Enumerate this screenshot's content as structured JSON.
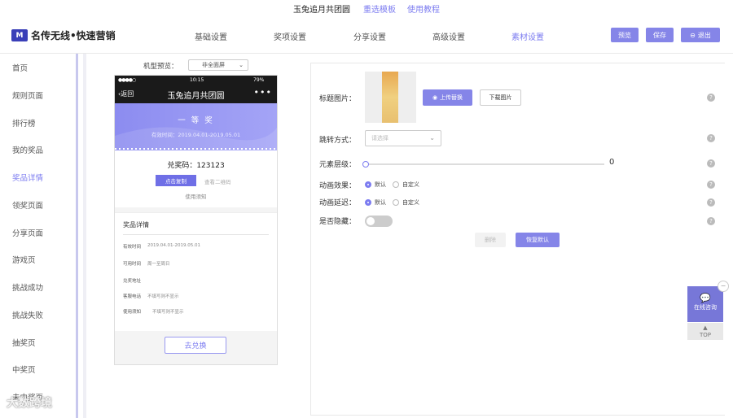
{
  "topbar": {
    "title": "玉兔追月共团圆",
    "reselect_template": "重选模板",
    "tutorial": "使用教程"
  },
  "header": {
    "logo_mark": "M",
    "logo_text": "名传无线•快速营销",
    "nav": [
      "基础设置",
      "奖项设置",
      "分享设置",
      "高级设置",
      "素材设置"
    ],
    "active_nav": "素材设置",
    "preview_button": "预览",
    "save_button": "保存",
    "exit_button": "退出"
  },
  "sidebar": {
    "items": [
      "首页",
      "规则页面",
      "排行榜",
      "我的奖品",
      "奖品详情",
      "领奖页面",
      "分享页面",
      "游戏页",
      "挑战成功",
      "挑战失败",
      "抽奖页",
      "中奖页",
      "未中奖页"
    ],
    "active": "奖品详情"
  },
  "preview": {
    "model_label": "机型预览：",
    "model_value": "非全面屏",
    "status_time": "10:15",
    "status_battery": "79%",
    "status_signal": "●●●●○",
    "back": "返回",
    "title": "玉兔追月共团圆",
    "more": "•••",
    "prize_name": "一 等 奖",
    "validity": "有效时间：2019.04.01-2019.05.01",
    "code_label": "兑奖码：123123",
    "copy_button": "点击复制",
    "qr_link": "查看二维码",
    "usage_note": "使用须知",
    "details_title": "奖品详情",
    "details": [
      {
        "k": "有效时间",
        "v": "2019.04.01-2019.05.01"
      },
      {
        "k": "可用时间",
        "v": "周一至周日"
      },
      {
        "k": "兑奖地址",
        "v": ""
      },
      {
        "k": "客服电话",
        "v": "不填写则不显示"
      },
      {
        "k": "使用须知",
        "v": "不填写则不显示"
      }
    ],
    "redeem_button": "去兑换"
  },
  "settings": {
    "title_image_label": "标题图片：",
    "upload_button": "上传替换",
    "download_button": "下载图片",
    "jump_label": "跳转方式：",
    "jump_placeholder": "请选择",
    "layer_label": "元素层级：",
    "layer_value": "0",
    "anim_effect_label": "动画效果：",
    "anim_delay_label": "动画延迟：",
    "default_option": "默认",
    "custom_option": "自定义",
    "anim_effect_selected": "默认",
    "anim_delay_selected": "默认",
    "hide_label": "是否隐藏：",
    "hidden": false,
    "delete_button": "删除",
    "restore_button": "恢复默认",
    "help_icon": "?"
  },
  "float": {
    "consult_label": "在线咨询",
    "top_label": "TOP",
    "close": "−"
  },
  "watermark": "大数跨境",
  "colors": {
    "accent": "#8585e8",
    "active_text": "#7c7cf0"
  }
}
